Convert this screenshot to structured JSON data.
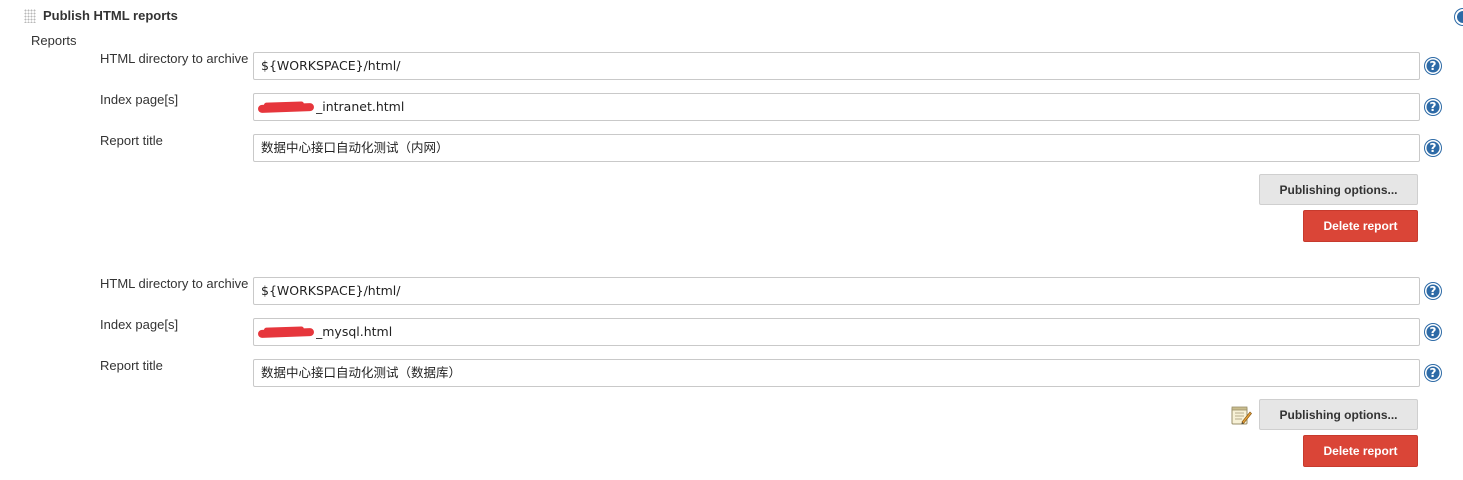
{
  "section": {
    "title": "Publish HTML reports",
    "reports_label": "Reports"
  },
  "reports": [
    {
      "dir_label": "HTML directory to archive",
      "dir_value": "${WORKSPACE}/html/",
      "index_label": "Index page[s]",
      "index_value": "_intranet.html",
      "title_label": "Report title",
      "title_value": "数据中心接口自动化测试（内网）",
      "publishing_options": "Publishing options...",
      "delete": "Delete report"
    },
    {
      "dir_label": "HTML directory to archive",
      "dir_value": "${WORKSPACE}/html/",
      "index_label": "Index page[s]",
      "index_value": "_mysql.html",
      "title_label": "Report title",
      "title_value": "数据中心接口自动化测试（数据库）",
      "publishing_options": "Publishing options...",
      "delete": "Delete report"
    }
  ],
  "help_glyph": "?",
  "icons": {
    "help": "question-circle-icon",
    "drag": "drag-handle-icon",
    "notepad": "notepad-icon"
  },
  "colors": {
    "delete_button": "#da4537",
    "help_icon": "#2d6aa6",
    "publish_button": "#e6e6e6"
  }
}
